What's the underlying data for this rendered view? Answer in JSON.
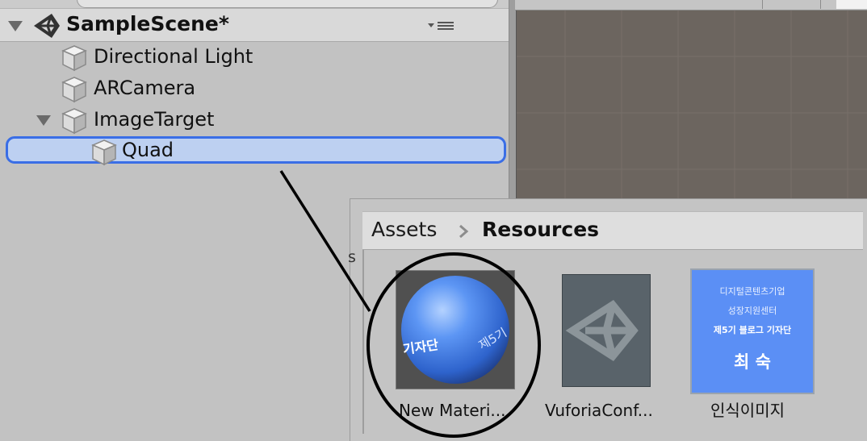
{
  "hierarchy": {
    "scene_name": "SampleScene*",
    "items": [
      {
        "label": "Directional Light"
      },
      {
        "label": "ARCamera"
      },
      {
        "label": "ImageTarget"
      },
      {
        "label": "Quad",
        "selected": true
      }
    ]
  },
  "project": {
    "breadcrumb": {
      "root": "Assets",
      "current": "Resources"
    },
    "side_letter": "s",
    "assets": [
      {
        "label": "New Materi...",
        "icon": "material-sphere-icon",
        "sphere_text": [
          "기자단",
          "제5기"
        ]
      },
      {
        "label": "VuforiaConf...",
        "icon": "unity-logo-icon"
      },
      {
        "label": "인식이미지",
        "icon": "image-texture-icon",
        "image_text": [
          "디지털콘텐츠기업",
          "성장지원센터",
          "제5기 블로그 기자단",
          "최 숙"
        ]
      }
    ]
  },
  "colors": {
    "selection_fill": "#bdd0f1",
    "selection_border": "#3a6ee6",
    "scene_background": "#6c655f",
    "image_thumb": "#5b8ff5"
  }
}
